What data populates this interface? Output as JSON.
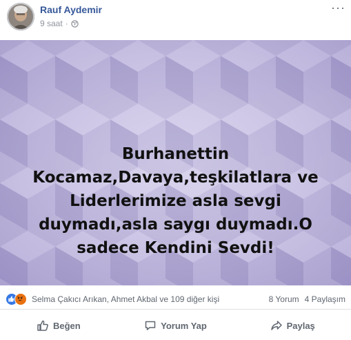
{
  "post": {
    "author": "Rauf Aydemir",
    "time": "9 saat",
    "separator": "·",
    "privacy_icon": "globe-icon",
    "more_icon": "more-options-icon",
    "more_label": "···",
    "image_text": "Burhanettin\nKocamaz,Davaya,teşkilatlara ve\nLiderlerimize asla sevgi\nduymadı,asla saygı duymadı.O\nsadece Kendini Sevdi!",
    "card_color": "#c1b9dd"
  },
  "stats": {
    "reaction_icons": [
      "like-reaction-icon",
      "angry-reaction-icon"
    ],
    "reactors": "Selma Çakıcı Arıkan, Ahmet Akbal ve 109 diğer kişi",
    "comments": "8 Yorum",
    "shares": "4 Paylaşım"
  },
  "actions": {
    "like_label": "Beğen",
    "comment_label": "Yorum Yap",
    "share_label": "Paylaş"
  },
  "colors": {
    "author_link": "#365899",
    "meta_text": "#90949c",
    "like_blue": "#3578e5",
    "angry_orange": "#e9710f",
    "action_text": "#606770"
  }
}
